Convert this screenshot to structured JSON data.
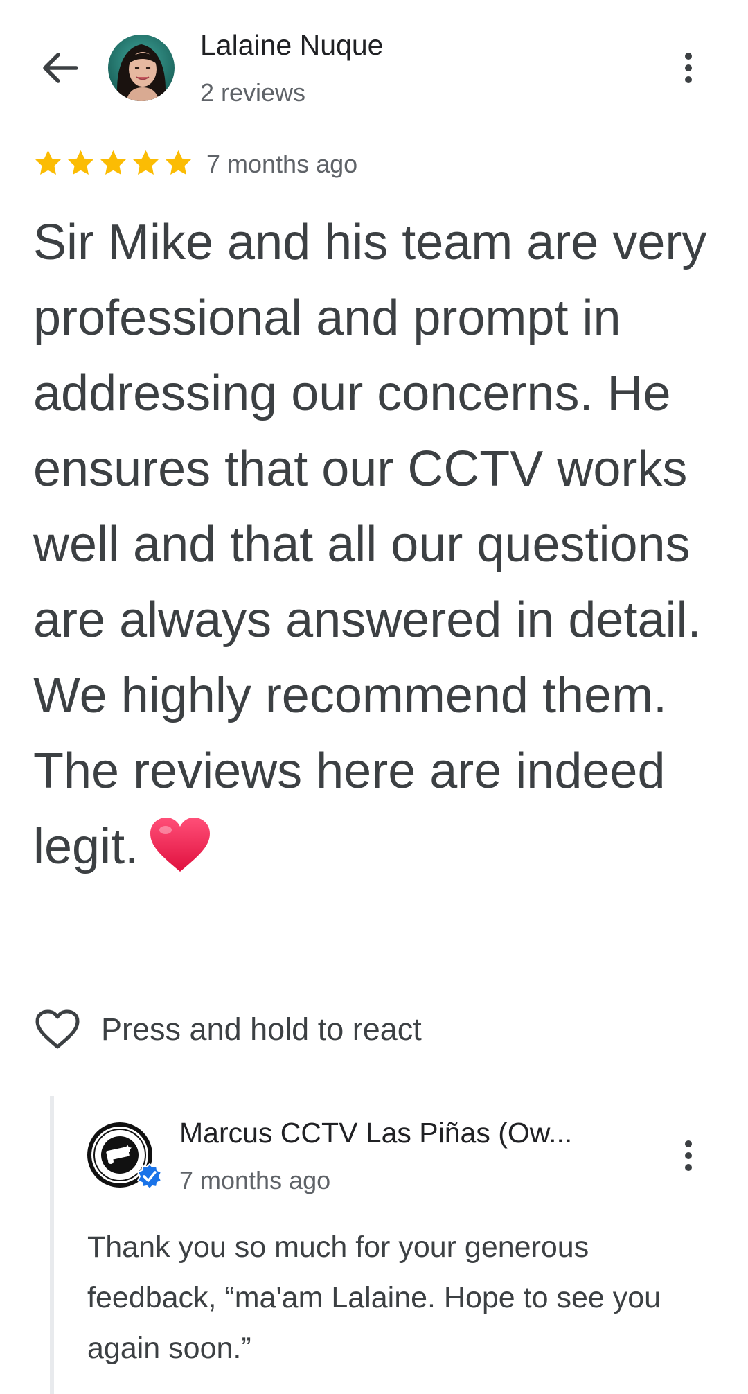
{
  "reviewer": {
    "name": "Lalaine Nuque",
    "review_count": "2 reviews",
    "avatar_icon": "person-avatar-photo"
  },
  "review": {
    "rating": 5,
    "rating_max": 5,
    "star_color": "#fbbc04",
    "time": "7 months ago",
    "text": "Sir Mike and his team are very professional and prompt in addressing our concerns. He ensures that our CCTV works well and that all our questions are always answered in detail. We highly recommend them. The reviews here are indeed legit.",
    "emoji_icon": "red-heart-emoji"
  },
  "actions": {
    "react_label": "Press and hold to react",
    "react_icon": "heart-outline-icon"
  },
  "owner_reply": {
    "name": "Marcus CCTV Las Piñas (Ow...",
    "time": "7 months ago",
    "logo_icon": "marcus-cctv-logo",
    "verified_icon": "verified-check-icon",
    "verified_color": "#1a73e8",
    "text": "Thank you so much for your generous feedback, “ma'am Lalaine. Hope to see you again soon.”"
  },
  "icons": {
    "back": "arrow-back-icon",
    "more": "more-vert-icon"
  },
  "colors": {
    "text_primary": "#202124",
    "text_body": "#3c4043",
    "text_secondary": "#5f6368",
    "divider": "#e8eaed",
    "heart_red": "#e8184a"
  }
}
